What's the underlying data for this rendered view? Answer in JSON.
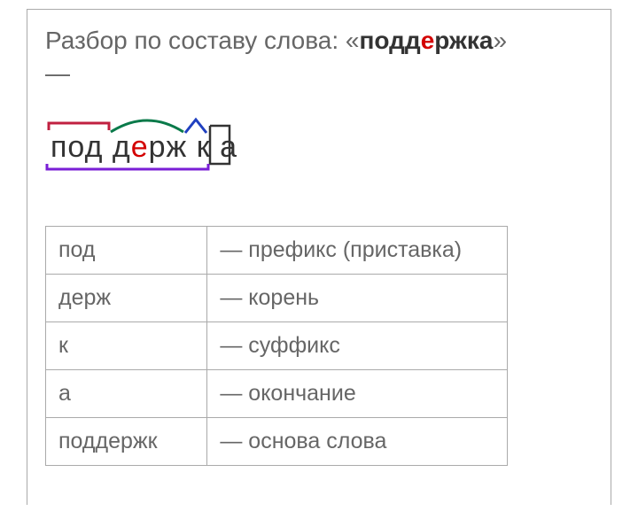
{
  "title": {
    "prefix_text": "Разбор по составу слова: «",
    "word_before_accent": "подд",
    "word_accent": "е",
    "word_after_accent": "ржка",
    "suffix_text": "»",
    "dash": "—"
  },
  "morph_display": {
    "p1": "под ",
    "p2": "д",
    "p3_accent": "е",
    "p4": "рж ",
    "p5": "к ",
    "p6": "а"
  },
  "table": {
    "rows": [
      {
        "morph": "под",
        "desc": "— префикс (приставка)"
      },
      {
        "morph": "держ",
        "desc": "— корень"
      },
      {
        "morph": "к",
        "desc": "— суффикс"
      },
      {
        "morph": "а",
        "desc": "— окончание"
      },
      {
        "morph": "поддержк",
        "desc": "— основа слова"
      }
    ]
  }
}
